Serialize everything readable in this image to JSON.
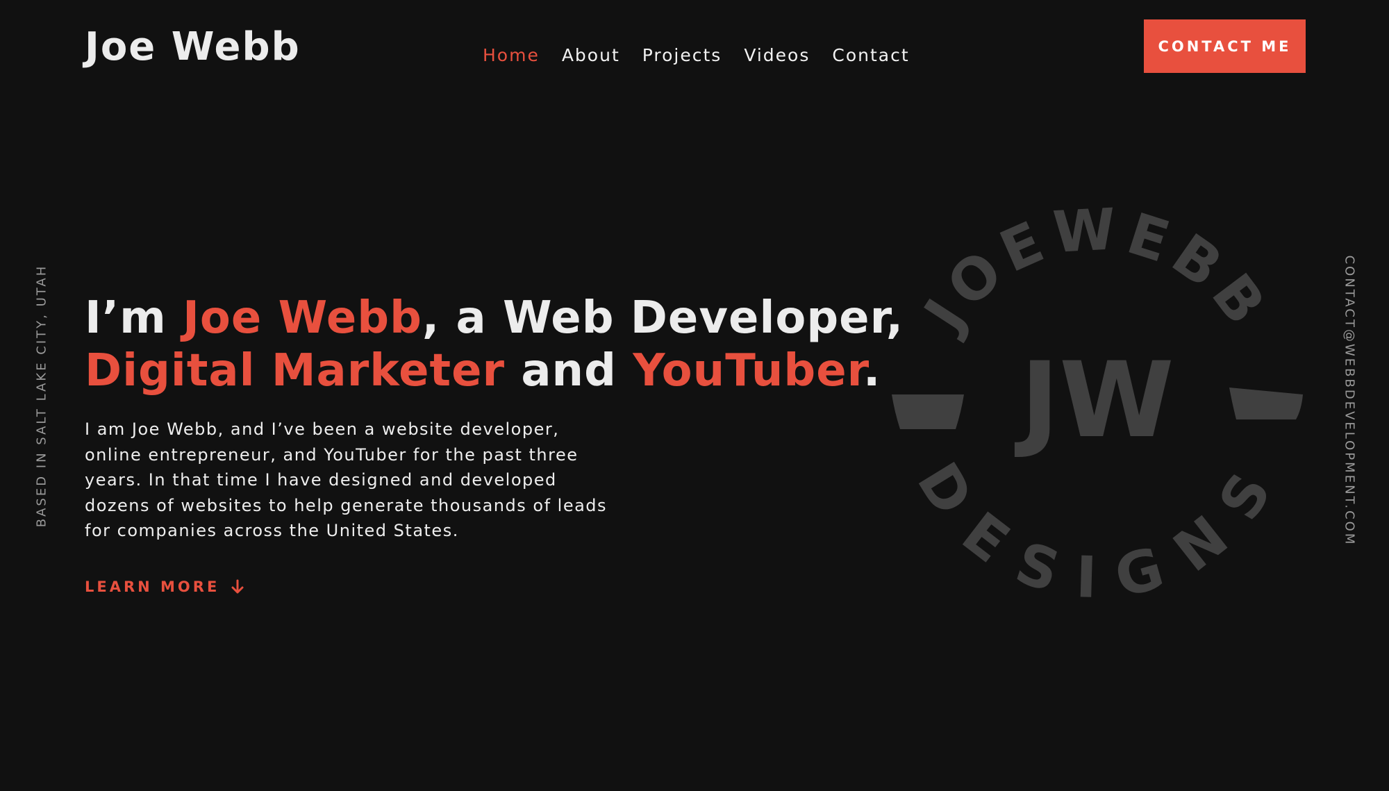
{
  "header": {
    "logo": "Joe Webb",
    "nav": [
      {
        "label": "Home",
        "active": true
      },
      {
        "label": "About",
        "active": false
      },
      {
        "label": "Projects",
        "active": false
      },
      {
        "label": "Videos",
        "active": false
      },
      {
        "label": "Contact",
        "active": false
      }
    ],
    "cta_label": "CONTACT ME"
  },
  "side": {
    "left_text": "BASED IN SALT LAKE CITY, UTAH",
    "right_text": "CONTACT@WEBBDEVELOPMENT.COM"
  },
  "hero": {
    "headline": {
      "prefix": "I’m ",
      "name": "Joe Webb",
      "mid1": ", a Web Developer,",
      "role1": "Digital Marketer",
      "mid2": " and ",
      "role2": "YouTuber",
      "end": "."
    },
    "intro": "I am Joe Webb, and I’ve been a website developer, online entrepreneur, and YouTuber for the past three years. In that time I have designed and developed dozens of websites to help generate thousands of leads for companies across the United States.",
    "learn_more": "LEARN MORE",
    "learn_more_icon": "arrow-down-icon"
  },
  "badge": {
    "top_text": "JOEWEBB",
    "bottom_text": "DESIGNS",
    "monogram": "JW",
    "icon": "jw-designs-badge-icon"
  },
  "colors": {
    "background": "#111111",
    "accent": "#e8503e",
    "text": "#ececec",
    "muted": "#9a9a9a",
    "badge": "#404040"
  }
}
